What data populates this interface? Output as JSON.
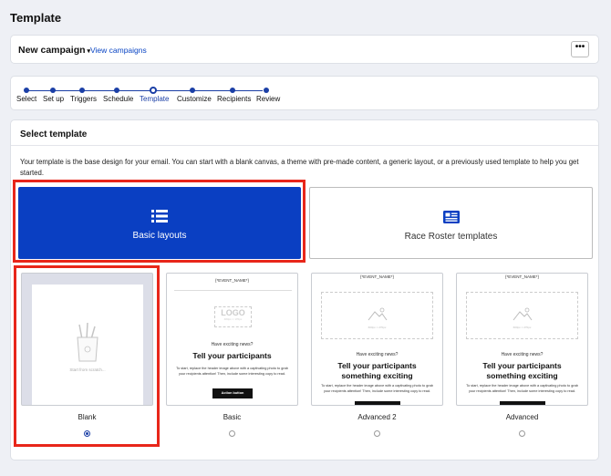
{
  "page": {
    "title": "Template"
  },
  "campaign": {
    "name": "New campaign",
    "caret": "▾",
    "view_link": "View campaigns",
    "more": "•••"
  },
  "stepper": {
    "steps": [
      {
        "label": "Select",
        "state": "done"
      },
      {
        "label": "Set up",
        "state": "done"
      },
      {
        "label": "Triggers",
        "state": "done"
      },
      {
        "label": "Schedule",
        "state": "done"
      },
      {
        "label": "Template",
        "state": "current"
      },
      {
        "label": "Customize",
        "state": "upcoming"
      },
      {
        "label": "Recipients",
        "state": "upcoming"
      },
      {
        "label": "Review",
        "state": "upcoming"
      }
    ]
  },
  "main": {
    "title": "Select template",
    "description": "Your template is the base design for your email. You can start with a blank canvas, a theme with pre-made content, a generic layout, or a previously used template to help you get started.",
    "template_types": [
      {
        "label": "Basic layouts",
        "icon": "list-icon",
        "selected": true
      },
      {
        "label": "Race Roster templates",
        "icon": "newspaper-icon",
        "selected": false
      }
    ],
    "templates": [
      {
        "name": "Blank",
        "selected": true,
        "preview": {
          "caption": "Start from scratch..."
        }
      },
      {
        "name": "Basic",
        "selected": false,
        "preview": {
          "event_name": "{*EVENT_NAME*}",
          "logo": "LOGO",
          "logo_size": "480px × 170px",
          "exciting": "Have exciting news?",
          "headline": "Tell your participants",
          "body": "To start, replace the header image above with a captivating photo to grab your recipients attention! Then, include some interesting copy to read.",
          "button": "Action button"
        }
      },
      {
        "name": "Advanced 2",
        "selected": false,
        "preview": {
          "event_name": "{*EVENT_NAME*}",
          "hero_size": "600px × 270px",
          "exciting": "Have exciting news?",
          "headline": "Tell your participants something exciting",
          "body": "To start, replace the header image above with a captivating photo to grab your recipients attention! Then, include some interesting copy to read."
        }
      },
      {
        "name": "Advanced",
        "selected": false,
        "preview": {
          "event_name": "{*EVENT_NAME*}",
          "hero_size": "600px × 270px",
          "exciting": "Have exciting news?",
          "headline": "Tell your participants something exciting",
          "body": "To start, replace the header image above with a captivating photo to grab your recipients attention! Then, include some interesting copy to read."
        }
      }
    ]
  },
  "colors": {
    "primary": "#0a3fc2",
    "link": "#0a45c4",
    "highlight": "#e8261a",
    "stepper": "#1b3fa6"
  }
}
